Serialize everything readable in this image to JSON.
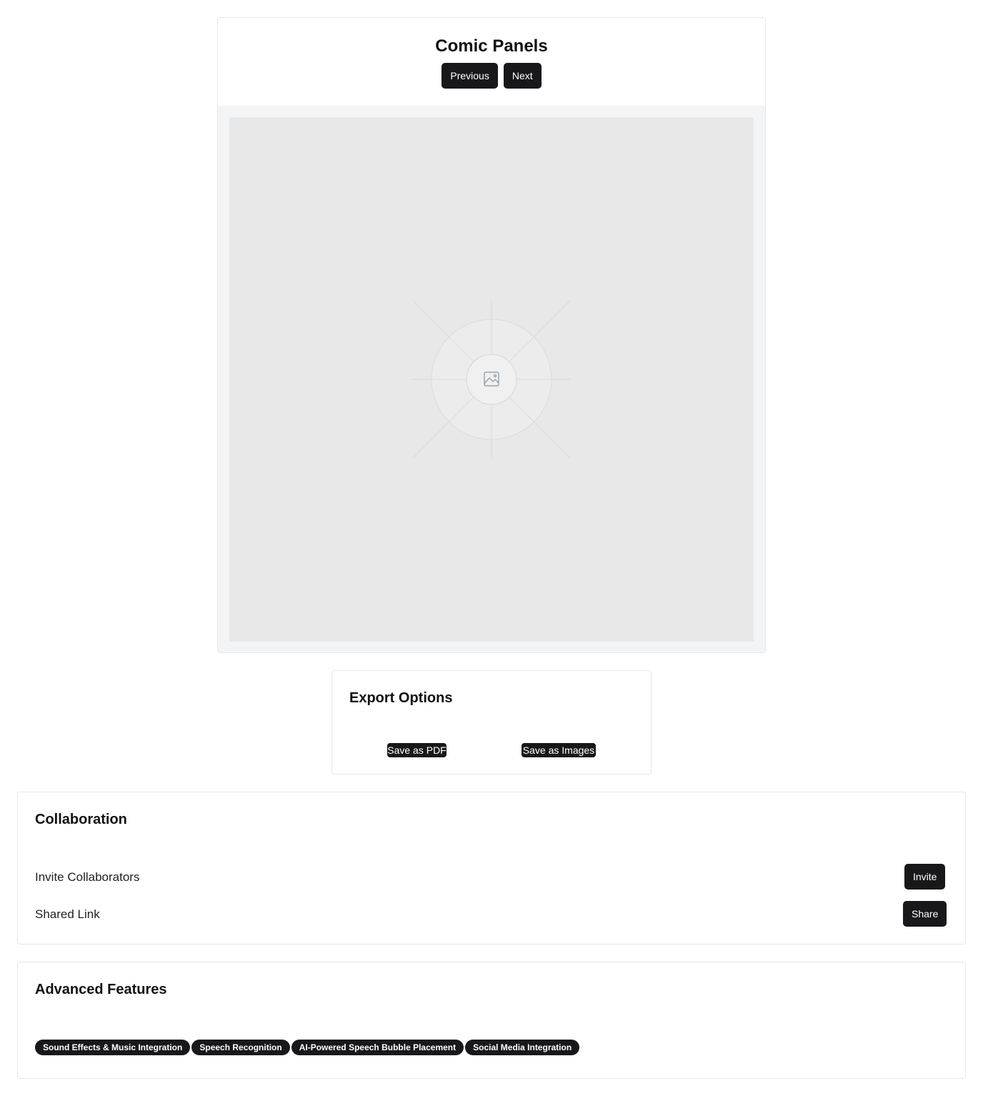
{
  "comic": {
    "title": "Comic Panels",
    "previous_label": "Previous",
    "next_label": "Next",
    "panel_icon": "image-placeholder-icon"
  },
  "export": {
    "title": "Export Options",
    "pdf_label": "Save as PDF",
    "images_label": "Save as Images"
  },
  "collaboration": {
    "title": "Collaboration",
    "rows": [
      {
        "label": "Invite Collaborators",
        "button": "Invite"
      },
      {
        "label": "Shared Link",
        "button": "Share"
      }
    ]
  },
  "advanced": {
    "title": "Advanced Features",
    "badges": [
      "Sound Effects & Music Integration",
      "Speech Recognition",
      "AI-Powered Speech Bubble Placement",
      "Social Media Integration"
    ]
  },
  "colors": {
    "button_bg": "#18181b",
    "panel_bg": "#e8e8e8",
    "card_border": "#e5e7eb"
  }
}
